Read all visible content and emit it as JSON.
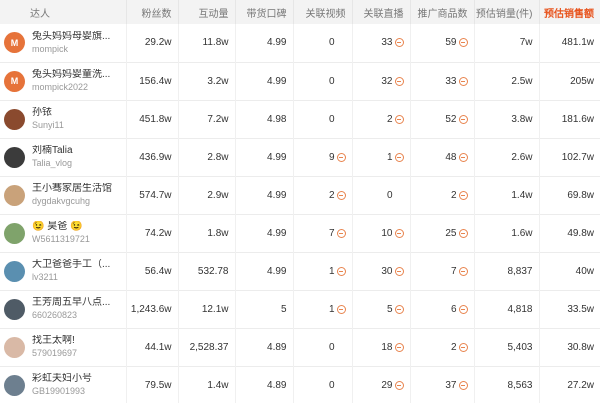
{
  "header": {
    "kol": "达人",
    "fans": "粉丝数",
    "interactions": "互动量",
    "reputation": "带货口碑",
    "linked_videos": "关联视频",
    "linked_lives": "关联直播",
    "products": "推广商品数",
    "est_sales": "预估销量(件)",
    "est_gmv": "预估销售额"
  },
  "colors": {
    "accent": "#e8541e",
    "more_icon": "#e8844e",
    "header_bg": "#f3f3f3"
  },
  "rows": [
    {
      "avatar_label": "M",
      "avatar_color": "#e6733a",
      "name": "兔头妈妈母婴旗...",
      "id": "mompick",
      "fans": "29.2w",
      "interactions": "11.8w",
      "reputation": "4.99",
      "videos": "0",
      "videos_more": false,
      "lives": "33",
      "lives_more": true,
      "products": "59",
      "products_more": true,
      "sales": "7w",
      "gmv": "481.1w"
    },
    {
      "avatar_label": "M",
      "avatar_color": "#e6733a",
      "name": "兔头妈妈婴童洗...",
      "id": "mompick2022",
      "fans": "156.4w",
      "interactions": "3.2w",
      "reputation": "4.99",
      "videos": "0",
      "videos_more": false,
      "lives": "32",
      "lives_more": true,
      "products": "33",
      "products_more": true,
      "sales": "2.5w",
      "gmv": "205w"
    },
    {
      "avatar_label": "",
      "avatar_color": "#8a4a2e",
      "name": "孙铱",
      "id": "Sunyi11",
      "fans": "451.8w",
      "interactions": "7.2w",
      "reputation": "4.98",
      "videos": "0",
      "videos_more": false,
      "lives": "2",
      "lives_more": true,
      "products": "52",
      "products_more": true,
      "sales": "3.8w",
      "gmv": "181.6w"
    },
    {
      "avatar_label": "",
      "avatar_color": "#3b3b3b",
      "name": "刘楠Talia",
      "id": "Talia_vlog",
      "fans": "436.9w",
      "interactions": "2.8w",
      "reputation": "4.99",
      "videos": "9",
      "videos_more": true,
      "lives": "1",
      "lives_more": true,
      "products": "48",
      "products_more": true,
      "sales": "2.6w",
      "gmv": "102.7w"
    },
    {
      "avatar_label": "",
      "avatar_color": "#c9a27a",
      "name": "王小骞家居生活馆",
      "id": "dygdakvgcuhg",
      "fans": "574.7w",
      "interactions": "2.9w",
      "reputation": "4.99",
      "videos": "2",
      "videos_more": true,
      "lives": "0",
      "lives_more": false,
      "products": "2",
      "products_more": true,
      "sales": "1.4w",
      "gmv": "69.8w"
    },
    {
      "avatar_label": "",
      "avatar_color": "#7fa36b",
      "name": "😉 昊爸 😉",
      "id": "W5611319721",
      "fans": "74.2w",
      "interactions": "1.8w",
      "reputation": "4.99",
      "videos": "7",
      "videos_more": true,
      "lives": "10",
      "lives_more": true,
      "products": "25",
      "products_more": true,
      "sales": "1.6w",
      "gmv": "49.8w"
    },
    {
      "avatar_label": "",
      "avatar_color": "#5a8fb0",
      "name": "大卫爸爸手工（...",
      "id": "lv3211",
      "fans": "56.4w",
      "interactions": "532.78",
      "reputation": "4.99",
      "videos": "1",
      "videos_more": true,
      "lives": "30",
      "lives_more": true,
      "products": "7",
      "products_more": true,
      "sales": "8,837",
      "gmv": "40w"
    },
    {
      "avatar_label": "",
      "avatar_color": "#4f5b66",
      "name": "王芳周五早八点...",
      "id": "660260823",
      "fans": "1,243.6w",
      "interactions": "12.1w",
      "reputation": "5",
      "videos": "1",
      "videos_more": true,
      "lives": "5",
      "lives_more": true,
      "products": "6",
      "products_more": true,
      "sales": "4,818",
      "gmv": "33.5w"
    },
    {
      "avatar_label": "",
      "avatar_color": "#d9b9a6",
      "name": "找王太啊!",
      "id": "579019697",
      "fans": "44.1w",
      "interactions": "2,528.37",
      "reputation": "4.89",
      "videos": "0",
      "videos_more": false,
      "lives": "18",
      "lives_more": true,
      "products": "2",
      "products_more": true,
      "sales": "5,403",
      "gmv": "30.8w"
    },
    {
      "avatar_label": "",
      "avatar_color": "#6d7f8f",
      "name": "彩虹夫妇小号",
      "id": "GB19901993",
      "fans": "79.5w",
      "interactions": "1.4w",
      "reputation": "4.89",
      "videos": "0",
      "videos_more": false,
      "lives": "29",
      "lives_more": true,
      "products": "37",
      "products_more": true,
      "sales": "8,563",
      "gmv": "27.2w"
    }
  ]
}
